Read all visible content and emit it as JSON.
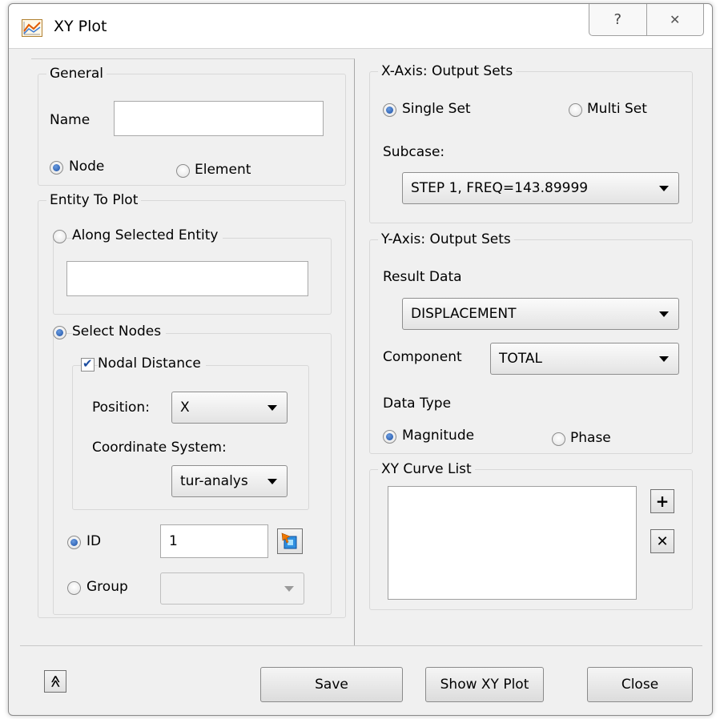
{
  "window": {
    "title": "XY Plot",
    "help_glyph": "?",
    "close_glyph": "✕"
  },
  "general": {
    "legend": "General",
    "name_label": "Name",
    "name_value": "",
    "node_label": "Node",
    "element_label": "Element"
  },
  "entity": {
    "legend": "Entity To Plot",
    "along_label": "Along Selected Entity",
    "along_value": "",
    "select_nodes_label": "Select Nodes",
    "nodal_distance_label": "Nodal Distance",
    "position_label": "Position:",
    "position_value": "X",
    "coord_label": "Coordinate System:",
    "coord_value": "tur-analys",
    "id_label": "ID",
    "id_value": "1",
    "group_label": "Group",
    "group_value": ""
  },
  "xaxis": {
    "legend": "X-Axis: Output Sets",
    "single_label": "Single Set",
    "multi_label": "Multi Set",
    "subcase_label": "Subcase:",
    "subcase_value": "STEP 1, FREQ=143.89999"
  },
  "yaxis": {
    "legend": "Y-Axis: Output Sets",
    "result_label": "Result Data",
    "result_value": "DISPLACEMENT",
    "component_label": "Component",
    "component_value": "TOTAL",
    "datatype_label": "Data Type",
    "magnitude_label": "Magnitude",
    "phase_label": "Phase"
  },
  "curves": {
    "legend": "XY Curve List",
    "add_glyph": "+",
    "remove_glyph": "✕"
  },
  "footer": {
    "collapse_glyph": "≫",
    "save_label": "Save",
    "show_label": "Show XY Plot",
    "close_label": "Close"
  }
}
